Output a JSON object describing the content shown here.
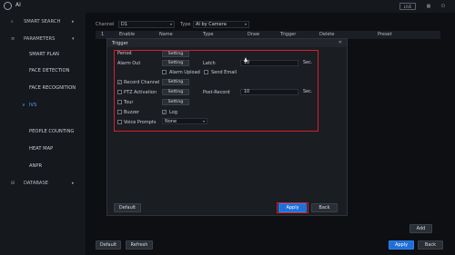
{
  "window": {
    "title": "AI",
    "live_label": "LIVE",
    "icons": [
      "grid-icon",
      "power-icon"
    ]
  },
  "sidebar": {
    "items": [
      {
        "label": "SMART SEARCH",
        "icon": "search-icon"
      },
      {
        "label": "PARAMETERS",
        "icon": "list-icon"
      },
      {
        "label": "SMART PLAN"
      },
      {
        "label": "FACE DETECTION"
      },
      {
        "label": "FACE RECOGNITION"
      },
      {
        "label": "IVS"
      },
      {
        "label": "PEOPLE COUNTING"
      },
      {
        "label": "HEAT MAP"
      },
      {
        "label": "ANPR"
      },
      {
        "label": "DATABASE",
        "icon": "database-icon"
      }
    ]
  },
  "main": {
    "channel_label": "Channel",
    "channel_value": "D1",
    "type_label": "Type",
    "type_value": "AI by Camera",
    "columns": [
      "1",
      "Enable",
      "Name",
      "Type",
      "Draw",
      "Trigger",
      "Delete",
      "Preset"
    ],
    "add_label": "Add",
    "default_label": "Default",
    "refresh_label": "Refresh",
    "apply_label": "Apply",
    "back_label": "Back"
  },
  "dialog": {
    "title": "Trigger",
    "period_label": "Period",
    "alarm_out_label": "Alarm Out",
    "latch_label": "Latch",
    "latch_value": "10",
    "sec_label": "Sec.",
    "alarm_upload_label": "Alarm Upload",
    "send_email_label": "Send Email",
    "record_channel_label": "Record Channel",
    "ptz_label": "PTZ Activation",
    "post_record_label": "Post-Record",
    "post_record_value": "10",
    "tour_label": "Tour",
    "buzzer_label": "Buzzer",
    "log_label": "Log",
    "voice_prompts_label": "Voice Prompts",
    "voice_prompts_value": "None",
    "setting_label": "Setting",
    "default_label": "Default",
    "apply_label": "Apply",
    "back_label": "Back",
    "record_channel_checked": true,
    "log_checked": true
  },
  "colors": {
    "accent": "#1f6fd6",
    "highlight": "#d4202a",
    "active_nav": "#4da3ff"
  }
}
